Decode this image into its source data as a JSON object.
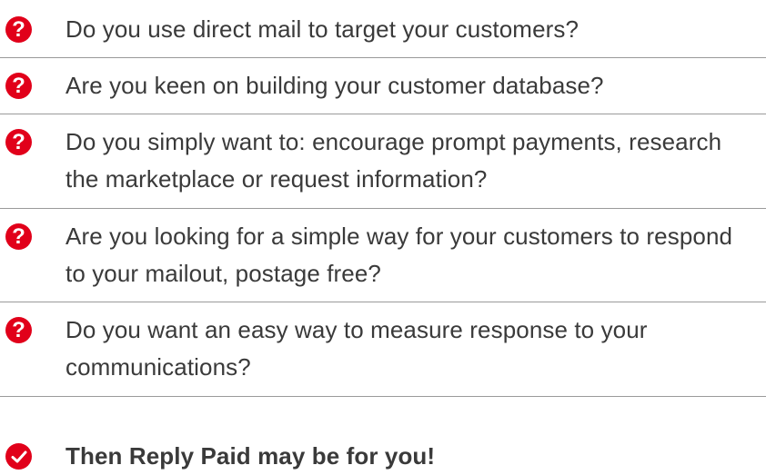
{
  "items": [
    {
      "icon": "question-icon",
      "text": "Do you use direct mail to target your customers?"
    },
    {
      "icon": "question-icon",
      "text": "Are you keen on building your customer database?"
    },
    {
      "icon": "question-icon",
      "text": "Do you simply want to: encourage prompt payments, research the marketplace or request information?"
    },
    {
      "icon": "question-icon",
      "text": "Are you looking for a simple way for your customers to respond to your mailout, postage free?"
    },
    {
      "icon": "question-icon",
      "text": "Do you want an easy way to measure response to your communications?"
    }
  ],
  "conclusion": {
    "icon": "checkmark-icon",
    "text": "Then Reply Paid may be for you!"
  },
  "colors": {
    "accent": "#e1001a",
    "text": "#3a3a3a",
    "divider": "#9a9a9a"
  }
}
